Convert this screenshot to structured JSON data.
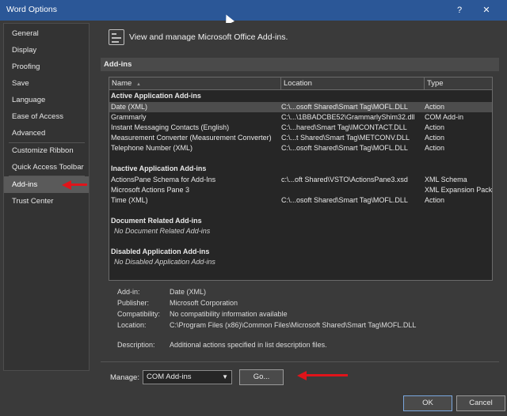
{
  "window": {
    "title": "Word Options",
    "help_glyph": "?",
    "close_glyph": "✕"
  },
  "sidebar": {
    "items": [
      {
        "label": "General"
      },
      {
        "label": "Display"
      },
      {
        "label": "Proofing"
      },
      {
        "label": "Save"
      },
      {
        "label": "Language"
      },
      {
        "label": "Ease of Access"
      },
      {
        "label": "Advanced"
      },
      {
        "label": "Customize Ribbon"
      },
      {
        "label": "Quick Access Toolbar"
      },
      {
        "label": "Add-ins",
        "selected": true
      },
      {
        "label": "Trust Center"
      }
    ]
  },
  "main": {
    "header_text": "View and manage Microsoft Office Add-ins.",
    "section_title": "Add-ins",
    "columns": {
      "name": "Name",
      "sort_glyph": "▲",
      "location": "Location",
      "type": "Type"
    },
    "groups": {
      "active": {
        "title": "Active Application Add-ins",
        "rows": [
          {
            "name": "Date (XML)",
            "location": "C:\\...osoft Shared\\Smart Tag\\MOFL.DLL",
            "type": "Action",
            "selected": true
          },
          {
            "name": "Grammarly",
            "location": "C:\\...\\1BBADCBE52\\GrammarlyShim32.dll",
            "type": "COM Add-in"
          },
          {
            "name": "Instant Messaging Contacts (English)",
            "location": "C:\\...hared\\Smart Tag\\IMCONTACT.DLL",
            "type": "Action"
          },
          {
            "name": "Measurement Converter (Measurement Converter)",
            "location": "C:\\...t Shared\\Smart Tag\\METCONV.DLL",
            "type": "Action"
          },
          {
            "name": "Telephone Number (XML)",
            "location": "C:\\...osoft Shared\\Smart Tag\\MOFL.DLL",
            "type": "Action"
          }
        ]
      },
      "inactive": {
        "title": "Inactive Application Add-ins",
        "rows": [
          {
            "name": "ActionsPane Schema for Add-Ins",
            "location": "c:\\...oft Shared\\VSTO\\ActionsPane3.xsd",
            "type": "XML Schema"
          },
          {
            "name": "Microsoft Actions Pane 3",
            "location": "",
            "type": "XML Expansion Pack"
          },
          {
            "name": "Time (XML)",
            "location": "C:\\...osoft Shared\\Smart Tag\\MOFL.DLL",
            "type": "Action"
          }
        ]
      },
      "document": {
        "title": "Document Related Add-ins",
        "empty_text": "No Document Related Add-ins"
      },
      "disabled": {
        "title": "Disabled Application Add-ins",
        "empty_text": "No Disabled Application Add-ins"
      }
    },
    "details": {
      "addin_label": "Add-in:",
      "addin_value": "Date (XML)",
      "publisher_label": "Publisher:",
      "publisher_value": "Microsoft Corporation",
      "compat_label": "Compatibility:",
      "compat_value": "No compatibility information available",
      "location_label": "Location:",
      "location_value": "C:\\Program Files (x86)\\Common Files\\Microsoft Shared\\Smart Tag\\MOFL.DLL",
      "description_label": "Description:",
      "description_value": "Additional actions specified in list description files."
    },
    "manage": {
      "label": "Manage:",
      "selected": "COM Add-ins",
      "go_label": "Go..."
    }
  },
  "footer": {
    "ok_label": "OK",
    "cancel_label": "Cancel"
  },
  "colors": {
    "title_bar": "#2b5797",
    "annotation_arrow": "#e0141a",
    "background": "#3a3a3a"
  }
}
